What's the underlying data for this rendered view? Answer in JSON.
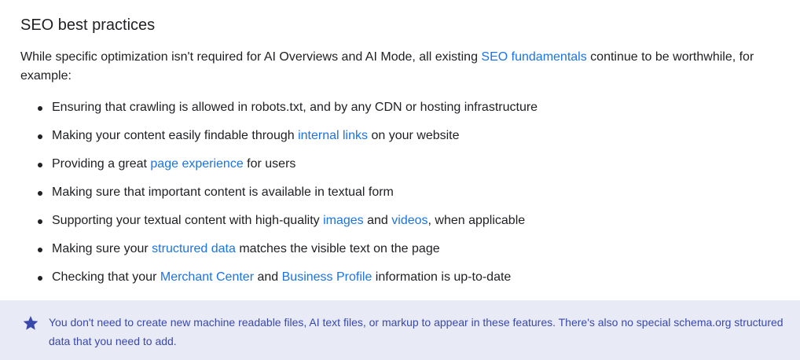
{
  "heading": "SEO best practices",
  "intro": {
    "before": "While specific optimization isn't required for AI Overviews and AI Mode, all existing ",
    "link": "SEO fundamentals",
    "after": " continue to be worthwhile, for example:"
  },
  "list": [
    {
      "t1": "Ensuring that crawling is allowed in robots.txt, and by any CDN or hosting infrastructure"
    },
    {
      "t1": "Making your content easily findable through ",
      "l1": "internal links",
      "t2": " on your website"
    },
    {
      "t1": "Providing a great ",
      "l1": "page experience",
      "t2": " for users"
    },
    {
      "t1": "Making sure that important content is available in textual form"
    },
    {
      "t1": "Supporting your textual content with high-quality ",
      "l1": "images",
      "t2": " and ",
      "l2": "videos",
      "t3": ", when applicable"
    },
    {
      "t1": "Making sure your ",
      "l1": "structured data",
      "t2": " matches the visible text on the page"
    },
    {
      "t1": "Checking that your ",
      "l1": "Merchant Center",
      "t2": " and ",
      "l2": "Business Profile",
      "t3": " information is up-to-date"
    }
  ],
  "note": {
    "icon": "star-icon",
    "text": "You don't need to create new machine readable files, AI text files, or markup to appear in these features. There's also no special schema.org structured data that you need to add."
  },
  "colors": {
    "link": "#1a73e8",
    "note_background": "#e8eaf6",
    "note_text": "#3949ab",
    "body_text": "#202124"
  }
}
